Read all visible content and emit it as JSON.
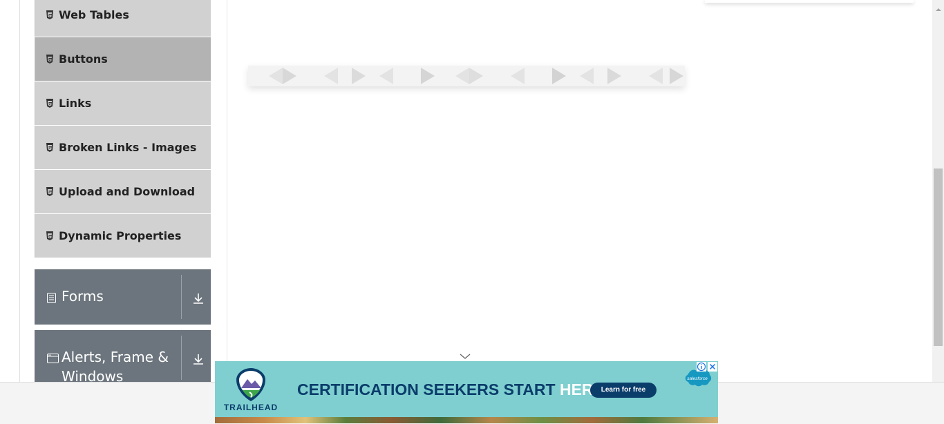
{
  "sidebar": {
    "items": [
      {
        "label": "Web Tables",
        "icon": "html5-icon",
        "active": false
      },
      {
        "label": "Buttons",
        "icon": "html5-icon",
        "active": true
      },
      {
        "label": "Links",
        "icon": "html5-icon",
        "active": false
      },
      {
        "label": "Broken Links - Images",
        "icon": "html5-icon",
        "active": false
      },
      {
        "label": "Upload and Download",
        "icon": "html5-icon",
        "active": false
      },
      {
        "label": "Dynamic Properties",
        "icon": "html5-icon",
        "active": false
      }
    ],
    "groups": [
      {
        "label": "Forms",
        "icon": "form-icon",
        "toggle_icon": "download-arrow-icon"
      },
      {
        "label": "Alerts, Frame & Windows",
        "icon": "window-icon",
        "toggle_icon": "download-arrow-icon"
      }
    ]
  },
  "ad": {
    "brand": "TRAILHEAD",
    "headline_main": "CERTIFICATION SEEKERS START ",
    "headline_highlight": "HERE.",
    "cta_label": "Learn for free",
    "partner": "salesforce",
    "collapse_icon": "chevron-down-icon",
    "info_icon": "info-icon",
    "close_icon": "close-icon"
  },
  "colors": {
    "sidebar_item_bg": "#d1d1d1",
    "sidebar_item_active_bg": "#b3b3b3",
    "group_bg": "#6c757d",
    "ad_bg": "#7fcfd0",
    "ad_text": "#0b3d6b"
  }
}
